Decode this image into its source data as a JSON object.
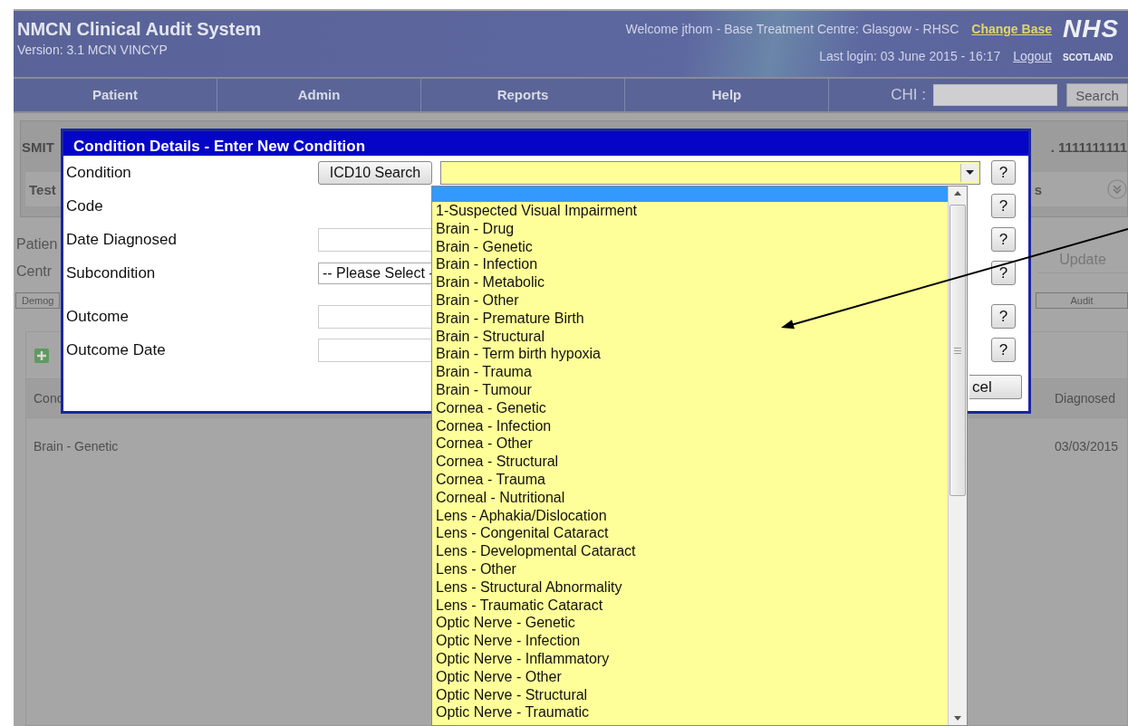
{
  "header": {
    "title": "NMCN Clinical Audit System",
    "version": "Version: 3.1 MCN VINCYP",
    "welcome": "Welcome jthom - Base Treatment Centre: Glasgow - RHSC",
    "change_base_link": "Change Base",
    "last_login": "Last login: 03 June 2015 - 16:17",
    "logout_link": "Logout",
    "logo": {
      "line_1": "NHS",
      "line_2": "SCOTLAND"
    }
  },
  "nav": {
    "items": [
      "Patient",
      "Admin",
      "Reports",
      "Help"
    ],
    "chi_label": "CHI :",
    "search_button": "Search"
  },
  "background": {
    "patient_name": "SMIT",
    "patient_id": ". 1111111111",
    "tab_row": {
      "left": "Test",
      "right": "s"
    },
    "info_labels": [
      "Patien",
      "Centr"
    ],
    "update_button": "Update",
    "section_tabs": [
      "Demog",
      "Audit"
    ],
    "table": {
      "columns": [
        "Conc",
        "Diagnosed"
      ],
      "rows": [
        [
          "Brain - Genetic",
          "03/03/2015"
        ]
      ]
    }
  },
  "dialog": {
    "title": "Condition Details - Enter New Condition",
    "rows": [
      {
        "label": "Condition",
        "kind": "icd_select",
        "button": "ICD10 Search",
        "help": "?"
      },
      {
        "label": "Code",
        "kind": "text",
        "help": "?"
      },
      {
        "label": "Date Diagnosed",
        "kind": "input",
        "help": "?"
      },
      {
        "label": "Subcondition",
        "kind": "select",
        "value": "-- Please Select -",
        "help": "?"
      },
      {
        "label": "Outcome",
        "kind": "input",
        "help": "?"
      },
      {
        "label": "Outcome Date",
        "kind": "input",
        "help": "?"
      }
    ],
    "cancel_button": "cel",
    "condition_dropdown": {
      "options": [
        {
          "kind": "blank",
          "selected": true
        },
        {
          "kind": "option",
          "label": "1-Suspected Visual Impairment",
          "selected": false
        },
        {
          "kind": "option",
          "label": "Brain - Drug",
          "selected": false
        },
        {
          "kind": "option",
          "label": "Brain - Genetic",
          "selected": false
        },
        {
          "kind": "option",
          "label": "Brain - Infection",
          "selected": false
        },
        {
          "kind": "option",
          "label": "Brain - Metabolic",
          "selected": false
        },
        {
          "kind": "option",
          "label": "Brain - Other",
          "selected": false
        },
        {
          "kind": "option",
          "label": "Brain - Premature Birth",
          "selected": false
        },
        {
          "kind": "option",
          "label": "Brain - Structural",
          "selected": false
        },
        {
          "kind": "option",
          "label": "Brain - Term birth hypoxia",
          "selected": false
        },
        {
          "kind": "option",
          "label": "Brain - Trauma",
          "selected": false
        },
        {
          "kind": "option",
          "label": "Brain - Tumour",
          "selected": false
        },
        {
          "kind": "option",
          "label": "Cornea - Genetic",
          "selected": false
        },
        {
          "kind": "option",
          "label": "Cornea - Infection",
          "selected": false
        },
        {
          "kind": "option",
          "label": "Cornea - Other",
          "selected": false
        },
        {
          "kind": "option",
          "label": "Cornea - Structural",
          "selected": false
        },
        {
          "kind": "option",
          "label": "Cornea - Trauma",
          "selected": false
        },
        {
          "kind": "option",
          "label": "Corneal - Nutritional",
          "selected": false
        },
        {
          "kind": "option",
          "label": "Lens - Aphakia/Dislocation",
          "selected": false
        },
        {
          "kind": "option",
          "label": "Lens - Congenital Cataract",
          "selected": false
        },
        {
          "kind": "option",
          "label": "Lens - Developmental Cataract",
          "selected": false
        },
        {
          "kind": "option",
          "label": "Lens - Other",
          "selected": false
        },
        {
          "kind": "option",
          "label": "Lens - Structural Abnormality",
          "selected": false
        },
        {
          "kind": "option",
          "label": "Lens - Traumatic Cataract",
          "selected": false
        },
        {
          "kind": "option",
          "label": "Optic Nerve - Genetic",
          "selected": false
        },
        {
          "kind": "option",
          "label": "Optic Nerve - Infection",
          "selected": false
        },
        {
          "kind": "option",
          "label": "Optic Nerve - Inflammatory",
          "selected": false
        },
        {
          "kind": "option",
          "label": "Optic Nerve - Other",
          "selected": false
        },
        {
          "kind": "option",
          "label": "Optic Nerve - Structural",
          "selected": false
        },
        {
          "kind": "option",
          "label": "Optic Nerve - Traumatic",
          "selected": false
        }
      ]
    }
  }
}
